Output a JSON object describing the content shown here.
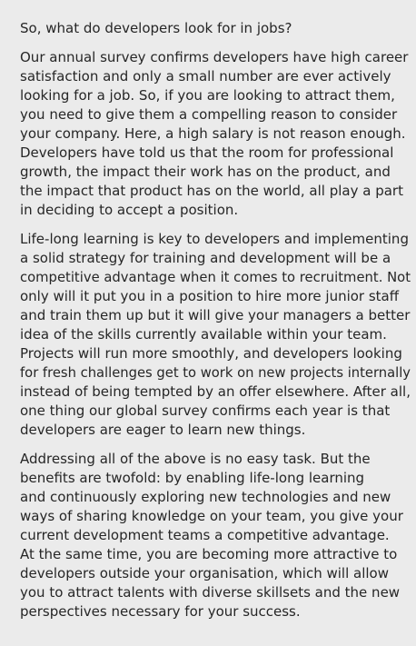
{
  "heading": "So, what do developers look for in jobs?",
  "paragraphs": [
    [
      "Our annual survey confirms developers have high career",
      "satisfaction and only a small number are ever actively",
      "looking for a job. So, if you are looking to attract them,",
      "you need to give them a compelling reason to consider",
      "your company. Here, a high salary is not reason enough.",
      "Developers have told us that the room for professional",
      "growth, the impact their work has on the product, and",
      "the impact that product has on the world, all play a part",
      "in deciding to accept a position."
    ],
    [
      "Life-long learning is key to developers and implementing",
      "a solid strategy for training and development will be a",
      "competitive advantage when it comes to recruitment. Not",
      "only will it put you in a position to hire more junior staff",
      "and train them up but it will give your managers a better",
      "idea of the skills currently available within your team.",
      "Projects will run more smoothly, and developers looking",
      "for fresh challenges get to work on new projects internally",
      "instead of being tempted by an offer elsewhere. After all,",
      "one thing our global survey confirms each year is that",
      "developers are eager to learn new things."
    ],
    [
      "Addressing all of the above is no easy task. But the",
      "benefits are twofold: by enabling life-long learning",
      "and continuously exploring new technologies and new",
      "ways of sharing knowledge on your team, you give your",
      "current development teams a competitive advantage.",
      "At the same time, you are becoming more attractive to",
      "developers outside your organisation, which will allow",
      "you to attract talents with diverse skillsets and the new",
      "perspectives necessary for your success."
    ]
  ]
}
